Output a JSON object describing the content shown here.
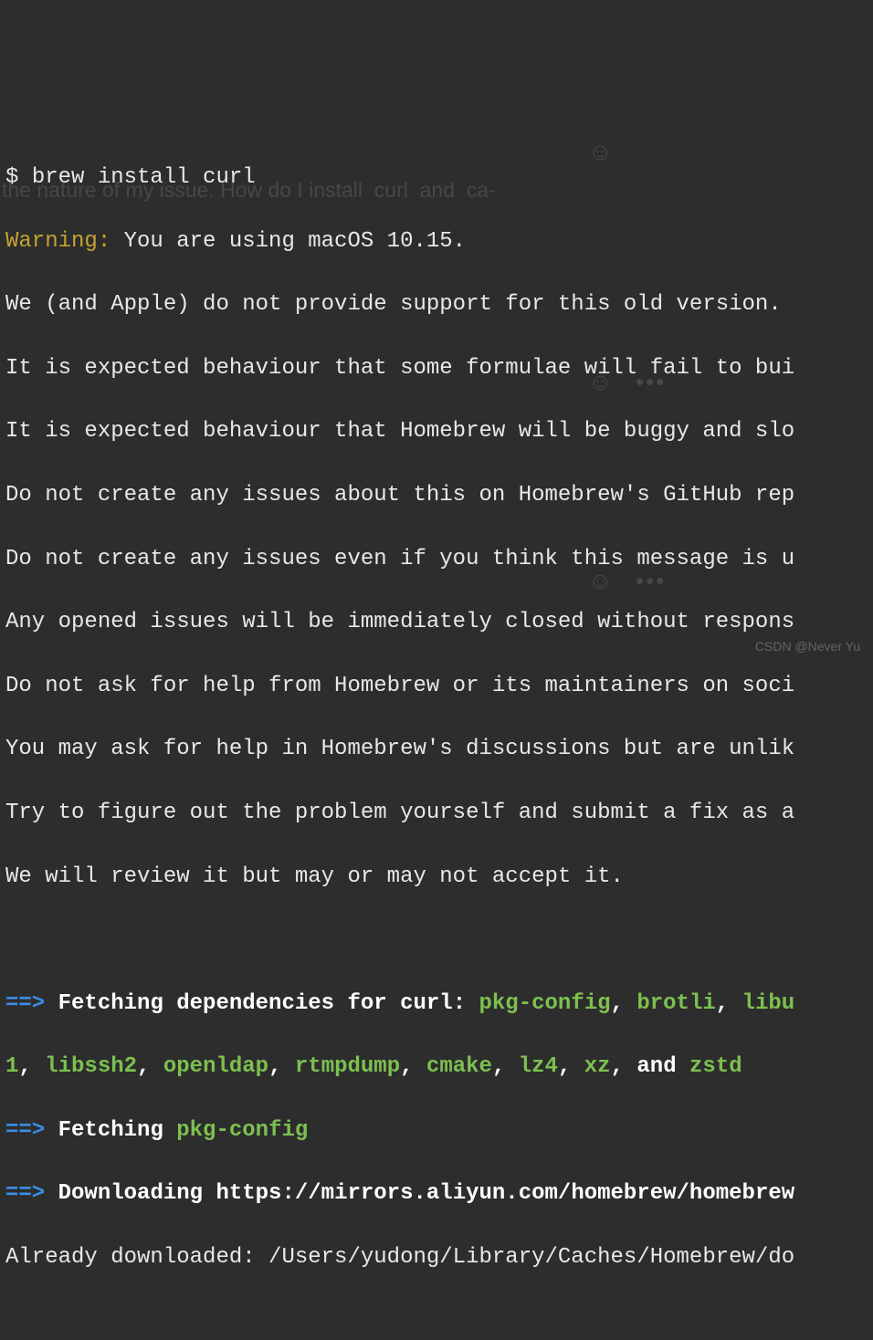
{
  "prompt": "$ ",
  "command": "brew install curl",
  "warning_label": "Warning:",
  "warning_msg": " You are using macOS 10.15.",
  "lines": [
    "We (and Apple) do not provide support for this old version.",
    "It is expected behaviour that some formulae will fail to bui",
    "It is expected behaviour that Homebrew will be buggy and slo",
    "Do not create any issues about this on Homebrew's GitHub rep",
    "Do not create any issues even if you think this message is u",
    "Any opened issues will be immediately closed without respons",
    "Do not ask for help from Homebrew or its maintainers on soci",
    "You may ask for help in Homebrew's discussions but are unlik",
    "Try to figure out the problem yourself and submit a fix as a",
    "We will review it but may or may not accept it."
  ],
  "arrow": "==>",
  "fetch_deps_label": " Fetching dependencies for curl: ",
  "deps1": [
    "pkg-config",
    "brotli",
    "libu"
  ],
  "deps2_prefix": "1",
  "deps2": [
    "libssh2",
    "openldap",
    "rtmpdump",
    "cmake",
    "lz4",
    "xz"
  ],
  "deps2_and": ", and ",
  "deps2_last": "zstd",
  "fetching_label": " Fetching ",
  "fetching_pkg": "pkg-config",
  "downloading_label": " Downloading https://mirrors.aliyun.com/homebrew/homebrew",
  "already_label": "Already downloaded: /Users/yudong/Library/Caches/Homebrew/do",
  "ghost_text": "the nature of my issue. How do I install  curl  and  ca-",
  "watermark": "CSDN @Never Yu"
}
